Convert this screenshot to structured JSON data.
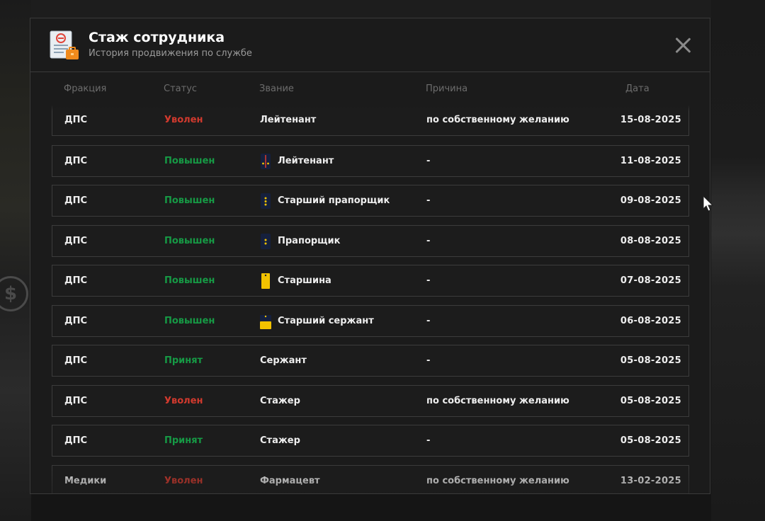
{
  "modal": {
    "title": "Стаж сотрудника",
    "subtitle": "История продвижения по службе"
  },
  "columns": {
    "faction": "Фракция",
    "status": "Статус",
    "rank": "Звание",
    "reason": "Причина",
    "date": "Дата"
  },
  "rows": [
    {
      "faction": "ДПС",
      "status": "Уволен",
      "status_type": "fired",
      "rank": "Лейтенант",
      "insignia": "none",
      "reason": "по собственному желанию",
      "date": "15-08-2025"
    },
    {
      "faction": "ДПС",
      "status": "Повышен",
      "status_type": "promoted",
      "rank": "Лейтенант",
      "insignia": "lieutenant-insignia-icon",
      "reason": "-",
      "date": "11-08-2025"
    },
    {
      "faction": "ДПС",
      "status": "Повышен",
      "status_type": "promoted",
      "rank": "Старший прапорщик",
      "insignia": "senior-warrant-officer-insignia-icon",
      "reason": "-",
      "date": "09-08-2025"
    },
    {
      "faction": "ДПС",
      "status": "Повышен",
      "status_type": "promoted",
      "rank": "Прапорщик",
      "insignia": "warrant-officer-insignia-icon",
      "reason": "-",
      "date": "08-08-2025"
    },
    {
      "faction": "ДПС",
      "status": "Повышен",
      "status_type": "promoted",
      "rank": "Старшина",
      "insignia": "sergeant-major-insignia-icon",
      "reason": "-",
      "date": "07-08-2025"
    },
    {
      "faction": "ДПС",
      "status": "Повышен",
      "status_type": "promoted",
      "rank": "Старший сержант",
      "insignia": "senior-sergeant-insignia-icon",
      "reason": "-",
      "date": "06-08-2025"
    },
    {
      "faction": "ДПС",
      "status": "Принят",
      "status_type": "hired",
      "rank": "Сержант",
      "insignia": "none",
      "reason": "-",
      "date": "05-08-2025"
    },
    {
      "faction": "ДПС",
      "status": "Уволен",
      "status_type": "fired",
      "rank": "Стажер",
      "insignia": "none",
      "reason": "по собственному желанию",
      "date": "05-08-2025"
    },
    {
      "faction": "ДПС",
      "status": "Принят",
      "status_type": "hired",
      "rank": "Стажер",
      "insignia": "none",
      "reason": "-",
      "date": "05-08-2025"
    },
    {
      "faction": "Медики",
      "status": "Уволен",
      "status_type": "fired",
      "rank": "Фармацевт",
      "insignia": "none",
      "reason": "по собственному желанию",
      "date": "13-02-2025"
    }
  ],
  "colors": {
    "fired": "#d23a2e",
    "promoted": "#169a45",
    "hired": "#169a45",
    "insignia_gold": "#f2c200",
    "insignia_navy": "#15203d"
  }
}
